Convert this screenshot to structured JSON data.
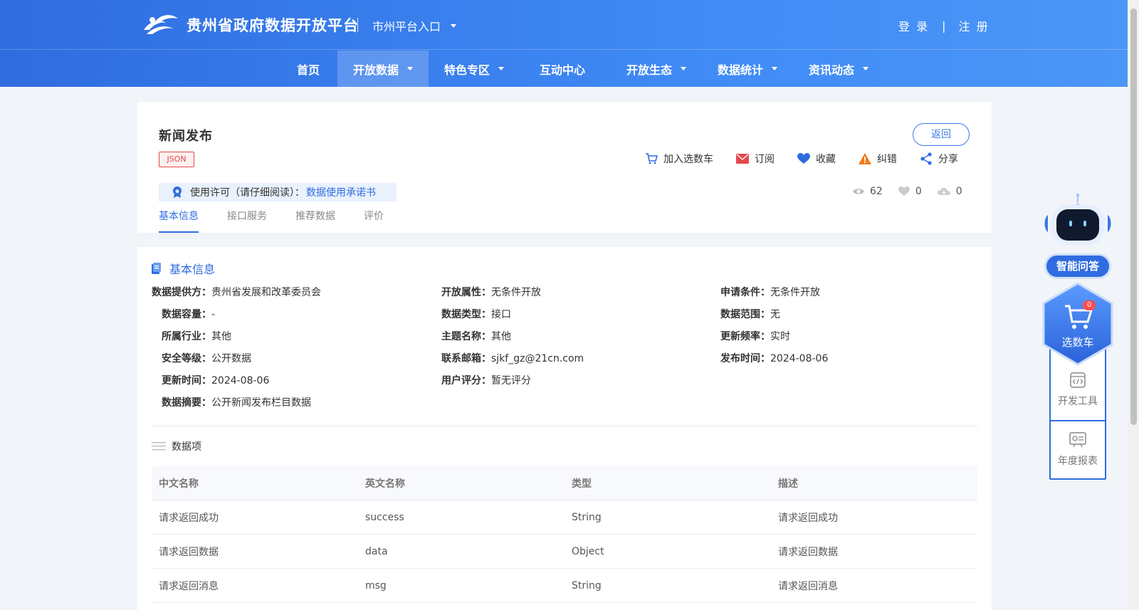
{
  "header": {
    "site_title": "贵州省政府数据开放平台",
    "city_entry": "市州平台入口",
    "login": "登 录",
    "auth_sep": "|",
    "register": "注 册"
  },
  "nav": {
    "items": [
      {
        "label": "首页"
      },
      {
        "label": "开放数据"
      },
      {
        "label": "特色专区"
      },
      {
        "label": "互动中心"
      },
      {
        "label": "开放生态"
      },
      {
        "label": "数据统计"
      },
      {
        "label": "资讯动态"
      }
    ],
    "active": "开放数据"
  },
  "dataset": {
    "title": "新闻发布",
    "format": "JSON",
    "back": "返回",
    "actions": {
      "add_cart": "加入选数车",
      "subscribe": "订阅",
      "favorite": "收藏",
      "report": "纠错",
      "share": "分享"
    },
    "license": {
      "text": "使用许可（请仔细阅读）：",
      "link": "数据使用承诺书"
    },
    "stats": {
      "views": "62",
      "likes": "0",
      "downloads": "0"
    },
    "tabs": [
      "基本信息",
      "接口服务",
      "推荐数据",
      "评价"
    ]
  },
  "basic_info": {
    "heading": "基本信息",
    "provider": {
      "k": "数据提供方：",
      "v": "贵州省发展和改革委员会"
    },
    "open_attr": {
      "k": "开放属性：",
      "v": "无条件开放"
    },
    "apply_cond": {
      "k": "申请条件：",
      "v": "无条件开放"
    },
    "capacity": {
      "k": "数据容量：",
      "v": "-"
    },
    "data_type": {
      "k": "数据类型：",
      "v": "接口"
    },
    "scope": {
      "k": "数据范围：",
      "v": "无"
    },
    "industry": {
      "k": "所属行业：",
      "v": "其他"
    },
    "topic": {
      "k": "主题名称：",
      "v": "其他"
    },
    "frequency": {
      "k": "更新频率：",
      "v": "实时"
    },
    "security": {
      "k": "安全等级：",
      "v": "公开数据"
    },
    "email": {
      "k": "联系邮箱：",
      "v": "sjkf_gz@21cn.com"
    },
    "published": {
      "k": "发布时间：",
      "v": "2024-08-06"
    },
    "updated": {
      "k": "更新时间：",
      "v": "2024-08-06"
    },
    "rating": {
      "k": "用户评分：",
      "v": "暂无评分"
    },
    "summary": {
      "k": "数据摘要：",
      "v": "公开新闻发布栏目数据"
    }
  },
  "data_items": {
    "heading": "数据项",
    "columns": [
      "中文名称",
      "英文名称",
      "类型",
      "描述"
    ],
    "rows": [
      [
        "请求返回成功",
        "success",
        "String",
        "请求返回成功"
      ],
      [
        "请求返回数据",
        "data",
        "Object",
        "请求返回数据"
      ],
      [
        "请求返回消息",
        "msg",
        "String",
        "请求返回消息"
      ]
    ]
  },
  "side": {
    "ask": "智能问答",
    "cart": "选数车",
    "cart_count": "0",
    "dev_tools": "开发工具",
    "annual_report": "年度报表"
  },
  "colors": {
    "brand": "#2f6ce0",
    "danger": "#e5484d",
    "warning": "#f07a1a"
  }
}
